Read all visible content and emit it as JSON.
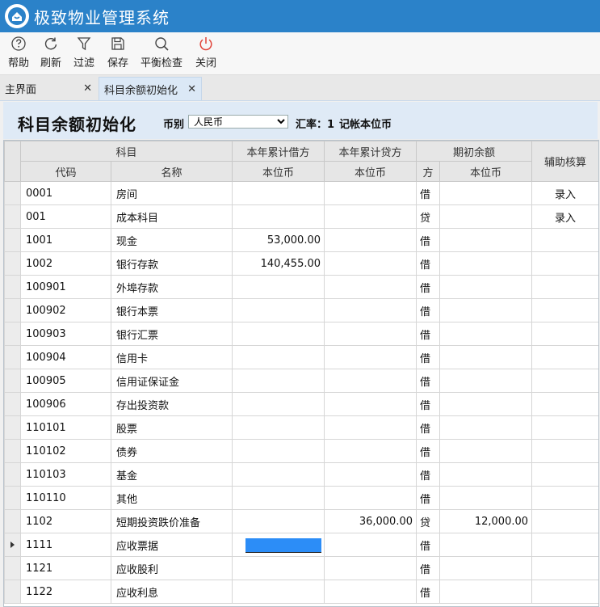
{
  "app": {
    "title": "极致物业管理系统"
  },
  "toolbar": {
    "help": "帮助",
    "refresh": "刷新",
    "filter": "过滤",
    "save": "保存",
    "balance_check": "平衡检查",
    "close": "关闭"
  },
  "tabs": [
    {
      "label": "主界面",
      "close": "✕"
    },
    {
      "label": "科目余额初始化",
      "close": "✕"
    }
  ],
  "header": {
    "title": "科目余额初始化",
    "currency_label": "币别",
    "currency_value": "人民币",
    "rate_label": "汇率：1",
    "book_currency_label": "记帐本位币"
  },
  "table": {
    "group_headers": {
      "subject": "科目",
      "debit": "本年累计借方",
      "credit": "本年累计贷方",
      "opening": "期初余额",
      "aux": "辅助核算"
    },
    "sub_headers": {
      "code": "代码",
      "name": "名称",
      "debit_cur": "本位币",
      "credit_cur": "本位币",
      "dir": "方",
      "opening_cur": "本位币"
    },
    "rows": [
      {
        "code": "0001",
        "name": "房间",
        "debit": "",
        "credit": "",
        "dir": "借",
        "opening": "",
        "aux": "录入"
      },
      {
        "code": "001",
        "name": "成本科目",
        "debit": "",
        "credit": "",
        "dir": "贷",
        "opening": "",
        "aux": "录入"
      },
      {
        "code": "1001",
        "name": "现金",
        "debit": "53,000.00",
        "credit": "",
        "dir": "借",
        "opening": "",
        "aux": ""
      },
      {
        "code": "1002",
        "name": "银行存款",
        "debit": "140,455.00",
        "credit": "",
        "dir": "借",
        "opening": "",
        "aux": ""
      },
      {
        "code": "100901",
        "name": "外埠存款",
        "debit": "",
        "credit": "",
        "dir": "借",
        "opening": "",
        "aux": ""
      },
      {
        "code": "100902",
        "name": "银行本票",
        "debit": "",
        "credit": "",
        "dir": "借",
        "opening": "",
        "aux": ""
      },
      {
        "code": "100903",
        "name": "银行汇票",
        "debit": "",
        "credit": "",
        "dir": "借",
        "opening": "",
        "aux": ""
      },
      {
        "code": "100904",
        "name": "信用卡",
        "debit": "",
        "credit": "",
        "dir": "借",
        "opening": "",
        "aux": ""
      },
      {
        "code": "100905",
        "name": "信用证保证金",
        "debit": "",
        "credit": "",
        "dir": "借",
        "opening": "",
        "aux": ""
      },
      {
        "code": "100906",
        "name": "存出投资款",
        "debit": "",
        "credit": "",
        "dir": "借",
        "opening": "",
        "aux": ""
      },
      {
        "code": "110101",
        "name": "股票",
        "debit": "",
        "credit": "",
        "dir": "借",
        "opening": "",
        "aux": ""
      },
      {
        "code": "110102",
        "name": "债券",
        "debit": "",
        "credit": "",
        "dir": "借",
        "opening": "",
        "aux": ""
      },
      {
        "code": "110103",
        "name": "基金",
        "debit": "",
        "credit": "",
        "dir": "借",
        "opening": "",
        "aux": ""
      },
      {
        "code": "110110",
        "name": "其他",
        "debit": "",
        "credit": "",
        "dir": "借",
        "opening": "",
        "aux": ""
      },
      {
        "code": "1102",
        "name": "短期投资跌价准备",
        "debit": "",
        "credit": "36,000.00",
        "dir": "贷",
        "opening": "12,000.00",
        "aux": ""
      },
      {
        "code": "1111",
        "name": "应收票据",
        "debit": "",
        "credit": "",
        "dir": "借",
        "opening": "",
        "aux": "",
        "current": true
      },
      {
        "code": "1121",
        "name": "应收股利",
        "debit": "",
        "credit": "",
        "dir": "借",
        "opening": "",
        "aux": ""
      },
      {
        "code": "1122",
        "name": "应收利息",
        "debit": "",
        "credit": "",
        "dir": "借",
        "opening": "",
        "aux": ""
      }
    ]
  },
  "colors": {
    "titlebar": "#2b82c9",
    "header_band": "#dfeaf6",
    "edit_highlight": "#2c8df7",
    "close_icon": "#e0443a"
  },
  "icons": [
    "logo-icon",
    "help-icon",
    "refresh-icon",
    "filter-icon",
    "save-icon",
    "search-icon",
    "power-icon",
    "row-pointer-icon"
  ]
}
